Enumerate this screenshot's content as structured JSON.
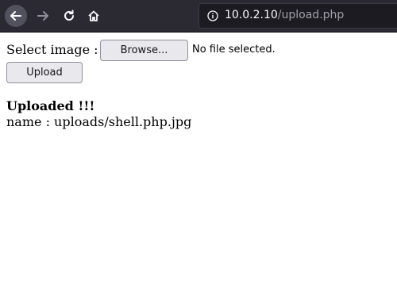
{
  "browser": {
    "url_host": "10.0.2.10",
    "url_path": "/upload.php"
  },
  "form": {
    "select_label": "Select image :",
    "browse_label": "Browse...",
    "file_status": "No file selected.",
    "upload_label": "Upload"
  },
  "result": {
    "title": "Uploaded !!!",
    "line": "name : uploads/shell.php.jpg"
  }
}
